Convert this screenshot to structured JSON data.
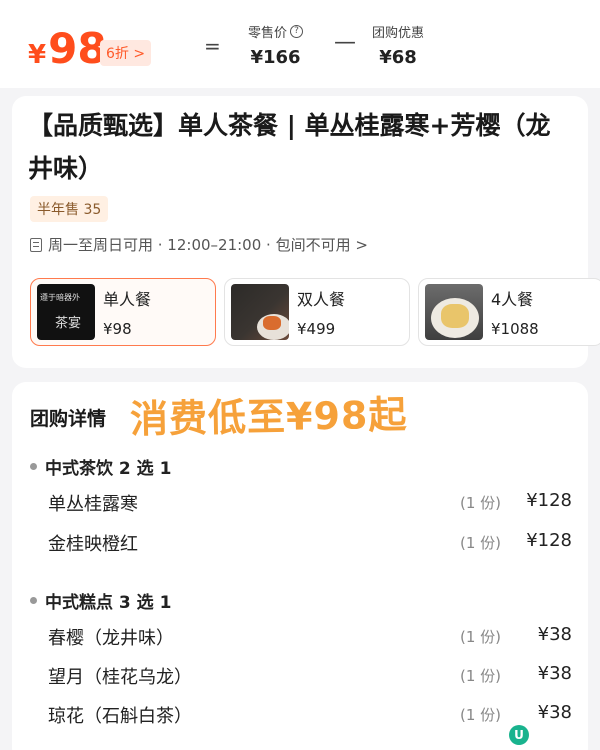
{
  "price": {
    "symbol": "¥",
    "amount": "98",
    "discount": "6折 >",
    "equal": "=",
    "minus": "—",
    "retail_label": "零售价",
    "retail_value": "¥166",
    "deal_label": "团购优惠",
    "deal_value": "¥68"
  },
  "product": {
    "title": "【品质甄选】单人茶餐 | 单丛桂露寒+芳樱（龙井味）",
    "sales": "半年售 35",
    "availability": "周一至周日可用 · 12:00–21:00 · 包间不可用 >",
    "options": [
      {
        "name": "单人餐",
        "price": "¥98",
        "thumb_line1": "遵于暗器外",
        "thumb_line2": "茶宴"
      },
      {
        "name": "双人餐",
        "price": "¥499"
      },
      {
        "name": "4人餐",
        "price": "¥1088"
      }
    ]
  },
  "details": {
    "title": "团购详情",
    "banner": "消费低至¥98起",
    "groups": [
      {
        "name": "中式茶饮 2 选 1",
        "items": [
          {
            "name": "单丛桂露寒",
            "qty": "(1 份)",
            "price": "¥128"
          },
          {
            "name": "金桂映橙红",
            "qty": "(1 份)",
            "price": "¥128"
          }
        ]
      },
      {
        "name": "中式糕点 3 选 1",
        "items": [
          {
            "name": "春樱（龙井味）",
            "qty": "(1 份)",
            "price": "¥38"
          },
          {
            "name": "望月（桂花乌龙）",
            "qty": "(1 份)",
            "price": "¥38"
          },
          {
            "name": "琼花（石斛白茶）",
            "qty": "(1 份)",
            "price": "¥38"
          }
        ]
      }
    ]
  },
  "colors": {
    "accent": "#ff4d1c",
    "banner": "#f6a13a",
    "selected_border": "#ff7a4d"
  },
  "icons": [
    "info-icon",
    "document-icon",
    "chevron-right-icon"
  ]
}
